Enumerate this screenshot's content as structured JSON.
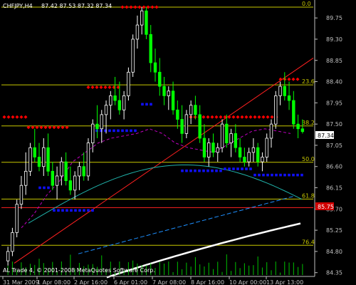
{
  "header": {
    "symbol": "CHFJPY,H4",
    "ohlc": "87.42 87.53 87.32 87.34"
  },
  "footer": {
    "copyright": "AL Trade 4, © 2001-2008 MetaQuotes Software Corp."
  },
  "colors": {
    "background": "#000000",
    "bull_candle": "#ffffff",
    "bear_candle": "#00ff00",
    "fib_line": "#c8c800",
    "trendline": "#ff2020",
    "support_line": "#ff2020",
    "dots_upper": "#ff0000",
    "dots_lower": "#1010ff",
    "ma_teal": "#20b2aa",
    "ma_blue": "#1e90ff",
    "ma_white": "#ffffff",
    "ma_magenta": "#c000c0",
    "price_label_bg": "#ffffff",
    "red_label_bg": "#d00000"
  },
  "chart_data": {
    "type": "candlestick",
    "symbol": "CHFJPY",
    "timeframe": "H4",
    "y_ticks": [
      "89.75",
      "89.30",
      "88.85",
      "88.40",
      "87.95",
      "87.50",
      "87.05",
      "86.60",
      "86.15",
      "85.70",
      "85.25",
      "84.80",
      "84.35"
    ],
    "x_ticks": [
      "31 Mar 2009",
      "1 Apr 08:00",
      "2 Apr 16:00",
      "6 Apr 01:00",
      "7 Apr 08:00",
      "8 Apr 16:00",
      "10 Apr 00:00",
      "13 Apr 13:00"
    ],
    "ylim": [
      84.3,
      90.1
    ],
    "fib_levels": [
      {
        "label": "0.0",
        "price": 89.98
      },
      {
        "label": "23.6",
        "price": 88.33
      },
      {
        "label": "38.2",
        "price": 87.46
      },
      {
        "label": "50.0",
        "price": 86.69
      },
      {
        "label": "61.8",
        "price": 85.91
      },
      {
        "label": "76.4",
        "price": 84.93
      }
    ],
    "current_price": "87.34",
    "red_level": "85.75",
    "candles_ohlc": [
      [
        84.6,
        84.9,
        84.5,
        84.8
      ],
      [
        84.8,
        85.3,
        84.7,
        85.2
      ],
      [
        85.2,
        85.9,
        85.1,
        85.8
      ],
      [
        85.8,
        86.4,
        85.7,
        86.2
      ],
      [
        86.2,
        86.9,
        86.0,
        86.5
      ],
      [
        86.5,
        87.1,
        86.4,
        87.0
      ],
      [
        87.0,
        87.4,
        86.7,
        86.8
      ],
      [
        86.8,
        87.1,
        86.5,
        86.6
      ],
      [
        86.6,
        87.2,
        86.4,
        87.0
      ],
      [
        87.0,
        87.3,
        86.4,
        86.5
      ],
      [
        86.5,
        86.7,
        86.1,
        86.2
      ],
      [
        86.2,
        86.6,
        85.9,
        86.4
      ],
      [
        86.4,
        86.8,
        86.2,
        86.7
      ],
      [
        86.7,
        86.9,
        86.2,
        86.3
      ],
      [
        86.3,
        86.6,
        86.0,
        86.1
      ],
      [
        86.1,
        86.5,
        85.9,
        86.4
      ],
      [
        86.4,
        86.7,
        86.1,
        86.6
      ],
      [
        86.6,
        86.9,
        86.3,
        86.4
      ],
      [
        86.4,
        87.2,
        86.3,
        87.1
      ],
      [
        87.1,
        87.6,
        86.9,
        87.5
      ],
      [
        87.5,
        87.9,
        87.2,
        87.4
      ],
      [
        87.4,
        87.8,
        87.1,
        87.7
      ],
      [
        87.7,
        88.0,
        87.3,
        87.9
      ],
      [
        87.9,
        88.2,
        87.6,
        88.1
      ],
      [
        88.1,
        88.5,
        87.9,
        88.0
      ],
      [
        88.0,
        88.4,
        87.7,
        87.8
      ],
      [
        87.8,
        88.2,
        87.6,
        88.1
      ],
      [
        88.1,
        88.7,
        88.0,
        88.6
      ],
      [
        88.6,
        89.4,
        88.5,
        89.3
      ],
      [
        89.3,
        89.8,
        89.1,
        89.6
      ],
      [
        89.6,
        89.98,
        89.4,
        89.9
      ],
      [
        89.9,
        89.98,
        89.3,
        89.4
      ],
      [
        89.4,
        89.6,
        88.6,
        88.8
      ],
      [
        88.8,
        89.1,
        88.4,
        88.6
      ],
      [
        88.6,
        88.9,
        88.1,
        88.3
      ],
      [
        88.3,
        88.5,
        87.9,
        88.1
      ],
      [
        88.1,
        88.3,
        87.8,
        88.2
      ],
      [
        88.2,
        88.4,
        87.7,
        87.8
      ],
      [
        87.8,
        88.0,
        87.4,
        87.6
      ],
      [
        87.6,
        87.9,
        87.1,
        87.3
      ],
      [
        87.3,
        87.8,
        87.2,
        87.7
      ],
      [
        87.7,
        88.0,
        87.5,
        87.9
      ],
      [
        87.9,
        88.1,
        87.6,
        87.7
      ],
      [
        87.7,
        87.9,
        87.1,
        87.2
      ],
      [
        87.2,
        87.5,
        86.7,
        86.8
      ],
      [
        86.8,
        87.2,
        86.6,
        87.1
      ],
      [
        87.1,
        87.3,
        86.8,
        86.9
      ],
      [
        86.9,
        87.1,
        86.7,
        87.0
      ],
      [
        87.0,
        87.6,
        86.9,
        87.5
      ],
      [
        87.5,
        87.7,
        87.0,
        87.1
      ],
      [
        87.1,
        87.4,
        86.8,
        87.3
      ],
      [
        87.3,
        87.5,
        86.9,
        87.0
      ],
      [
        87.0,
        87.2,
        86.7,
        86.8
      ],
      [
        86.8,
        87.0,
        86.6,
        86.7
      ],
      [
        86.7,
        87.0,
        86.6,
        86.9
      ],
      [
        86.9,
        87.2,
        86.7,
        87.0
      ],
      [
        87.0,
        87.1,
        86.6,
        86.7
      ],
      [
        86.7,
        86.9,
        86.5,
        86.8
      ],
      [
        86.8,
        87.3,
        86.7,
        87.2
      ],
      [
        87.2,
        87.6,
        87.0,
        87.5
      ],
      [
        87.5,
        88.2,
        87.4,
        88.1
      ],
      [
        88.1,
        88.4,
        87.9,
        88.3
      ],
      [
        88.3,
        88.6,
        88.0,
        88.1
      ],
      [
        88.1,
        88.4,
        87.8,
        88.0
      ],
      [
        88.0,
        88.2,
        87.4,
        87.5
      ],
      [
        87.5,
        87.7,
        87.2,
        87.4
      ],
      [
        87.4,
        87.6,
        87.3,
        87.34
      ]
    ]
  }
}
